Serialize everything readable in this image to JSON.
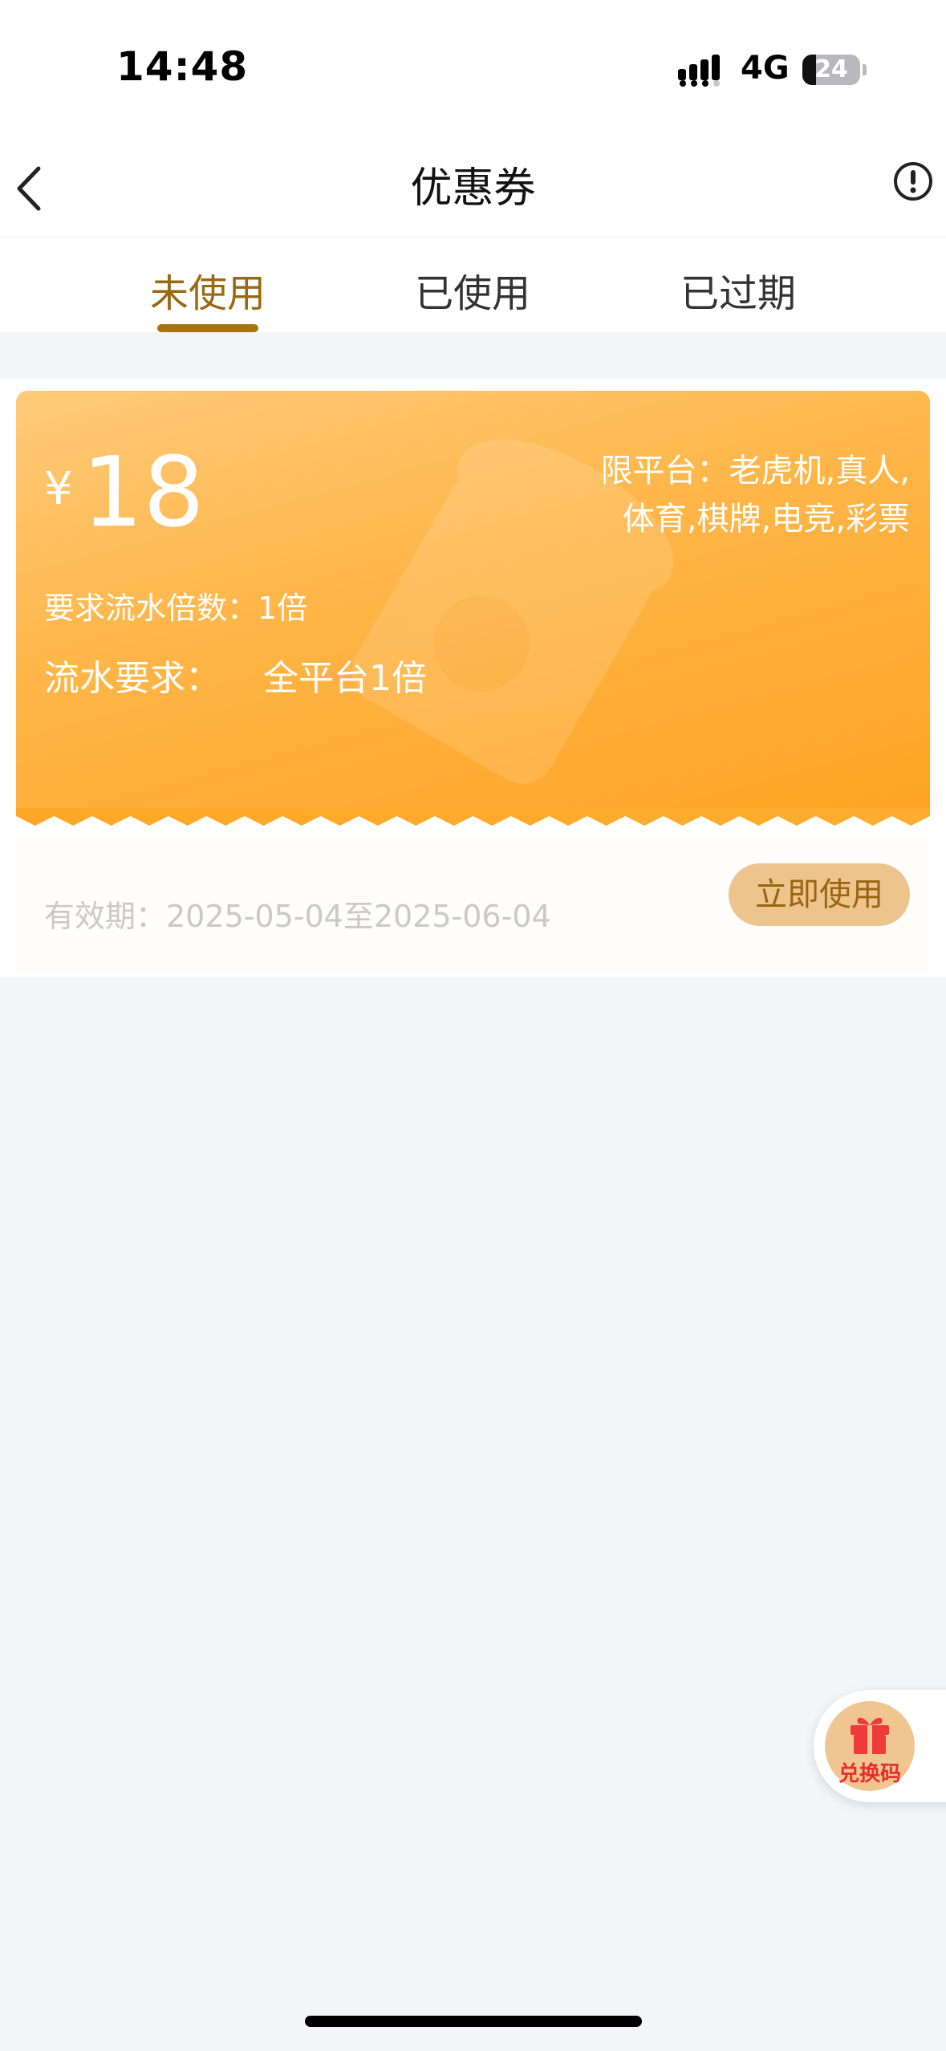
{
  "status_bar": {
    "time": "14:48",
    "network": "4G",
    "battery": "24",
    "battery_level": 0.24
  },
  "nav": {
    "title": "优惠券",
    "back_icon": "chevron-left-icon",
    "info_icon": "exclamation-circle-icon"
  },
  "tabs": [
    {
      "label": "未使用",
      "active": true
    },
    {
      "label": "已使用",
      "active": false
    },
    {
      "label": "已过期",
      "active": false
    }
  ],
  "coupon": {
    "currency_symbol": "¥",
    "amount": "18",
    "platform_line1": "限平台：老虎机,真人,",
    "platform_line2": "体育,棋牌,电竞,彩票",
    "turnover_multiplier": "要求流水倍数：1倍",
    "turnover_label": "流水要求：",
    "turnover_value": "全平台1倍",
    "validity": "有效期：2025-05-04至2025-06-04",
    "use_button": "立即使用"
  },
  "redeem": {
    "label": "兑换码",
    "icon": "gift-icon"
  },
  "colors": {
    "accent": "#a87410",
    "coupon_gradient_start": "#ffca7a",
    "coupon_gradient_end": "#ffa424",
    "button_bg": "#ecc48c",
    "redeem_text": "#e62e2e"
  }
}
